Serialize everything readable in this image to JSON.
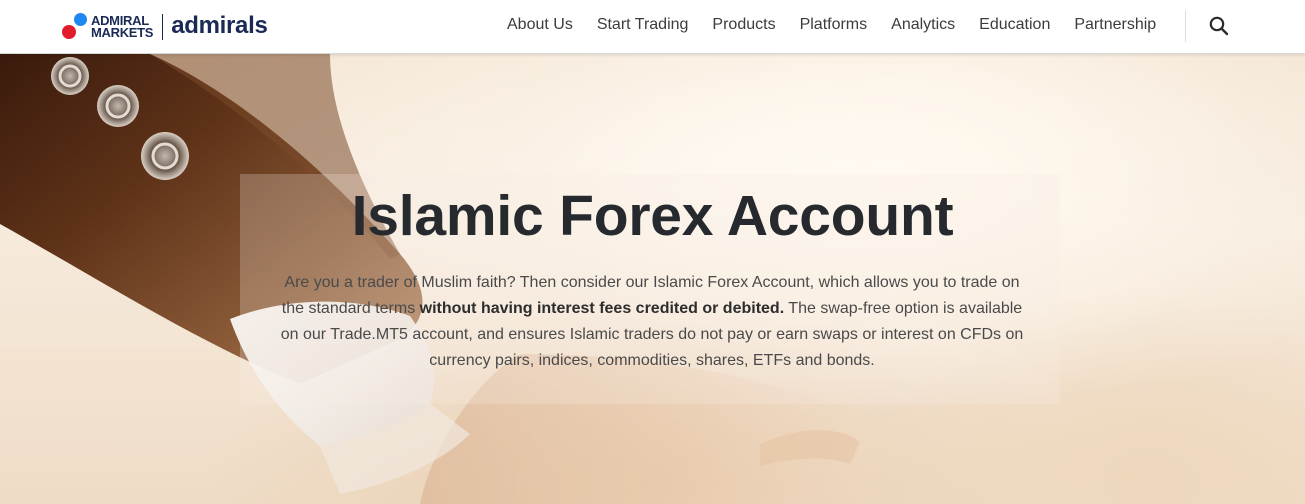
{
  "header": {
    "logo": {
      "line1": "ADMIRAL",
      "line2": "MARKETS",
      "brand": "admirals"
    },
    "nav_items": [
      "About Us",
      "Start Trading",
      "Products",
      "Platforms",
      "Analytics",
      "Education",
      "Partnership"
    ],
    "search_icon": "search-icon"
  },
  "hero": {
    "title": "Islamic Forex Account",
    "description": {
      "part1": "Are you a trader of Muslim faith? Then consider our Islamic Forex Account, which allows you to trade on the standard terms ",
      "bold": "without having interest fees credited or debited.",
      "part2": " The swap-free option is available on our Trade.MT5 account, and ensures Islamic traders do not pay or earn swaps or interest on CFDs on currency pairs, indices, commodities, shares, ETFs and bonds."
    }
  },
  "colors": {
    "brand_navy": "#1a2a55",
    "dot_blue": "#1e88f0",
    "dot_red": "#e01b2b",
    "title_text": "#262a2e"
  }
}
